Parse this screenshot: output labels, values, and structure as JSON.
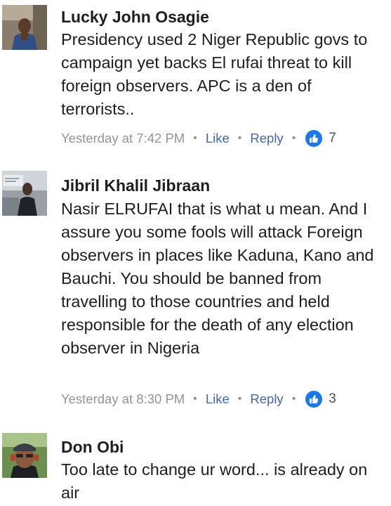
{
  "comments": [
    {
      "author": "Lucky John Osagie",
      "text": "Presidency used 2 Niger Republic govs to campaign yet backs El rufai threat to kill foreign observers.  APC is a den of terrorists..",
      "time": "Yesterday at 7:42 PM",
      "like_label": "Like",
      "reply_label": "Reply",
      "reaction_icon": "thumbs-up-icon",
      "reaction_count": "7"
    },
    {
      "author": "Jibril Khalil Jibraan",
      "text": "Nasir ELRUFAI  that is what u mean. And I assure you some fools will attack Foreign observers in places like Kaduna, Kano and Bauchi. You should be banned from travelling to those countries and held responsible for the death of any election observer in Nigeria",
      "time": "Yesterday at 8:30 PM",
      "like_label": "Like",
      "reply_label": "Reply",
      "reaction_icon": "thumbs-up-icon",
      "reaction_count": "3"
    },
    {
      "author": "Don Obi",
      "text": "Too late to change ur word... is already on air"
    }
  ],
  "separator": "•",
  "colors": {
    "link": "#4267b2",
    "meta_gray": "#90949c",
    "like_badge": "#1877f2",
    "text": "#1c1e21"
  }
}
